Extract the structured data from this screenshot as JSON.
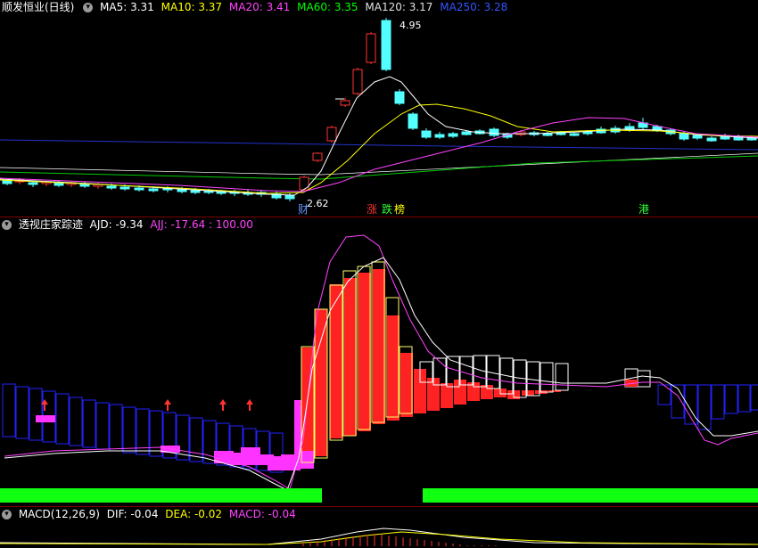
{
  "main": {
    "title": "顺发恒业(日线)",
    "ma": [
      {
        "label": "MA5: 3.31",
        "color": "#ffffff"
      },
      {
        "label": "MA10: 3.37",
        "color": "#ffff00"
      },
      {
        "label": "MA20: 3.41",
        "color": "#ff44ff"
      },
      {
        "label": "MA60: 3.35",
        "color": "#00ff00"
      },
      {
        "label": "MA120: 3.17",
        "color": "#e0e0e0"
      },
      {
        "label": "MA250: 3.28",
        "color": "#3355ff"
      }
    ],
    "high_label": "4.95",
    "low_label": "2.62",
    "tags": [
      {
        "text": "财",
        "color": "#6699ff"
      },
      {
        "text": "涨",
        "color": "#ff3333"
      },
      {
        "text": "跌",
        "color": "#33ff33"
      },
      {
        "text": "榜",
        "color": "#ffff00"
      },
      {
        "text": "港",
        "color": "#33ff33"
      }
    ]
  },
  "indicator": {
    "title": "透视庄家踪迹",
    "ajd": "AJD: -9.34",
    "ajj": "AJJ: -17.64",
    "val": ": 100.00",
    "colors": {
      "ajd": "#ffffff",
      "ajj": "#ff44ff"
    }
  },
  "macd": {
    "title": "MACD(12,26,9)",
    "dif": "DIF: -0.04",
    "dea": "DEA: -0.02",
    "macd": "MACD: -0.04",
    "colors": {
      "dif": "#ffffff",
      "dea": "#ffff00",
      "macd": "#ff44ff"
    }
  },
  "colors": {
    "up": "#ff3333",
    "down": "#54ffff",
    "fill_up": "#ff2222",
    "magenta": "#ff33ff",
    "green_bar": "#11ff11",
    "blue": "#2222ff"
  }
}
